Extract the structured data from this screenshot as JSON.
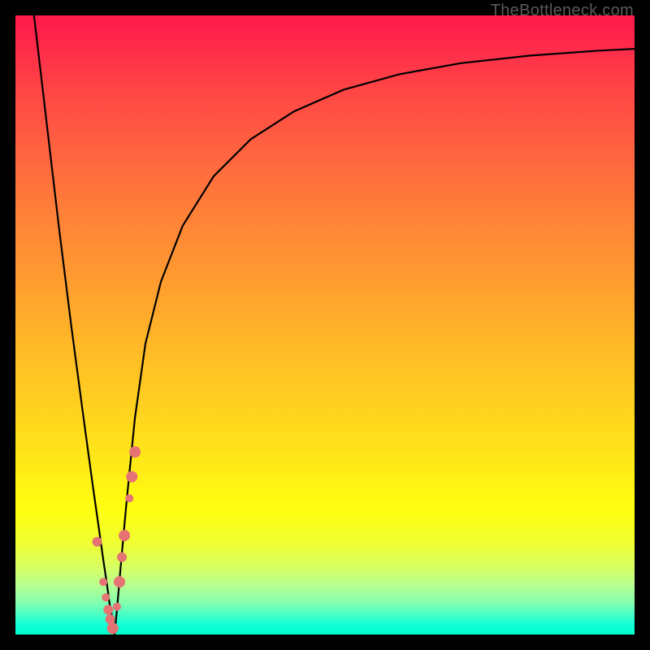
{
  "watermark": "TheBottleneck.com",
  "chart_data": {
    "type": "line",
    "title": "",
    "xlabel": "",
    "ylabel": "",
    "xlim": [
      0,
      100
    ],
    "ylim": [
      0,
      100
    ],
    "series": [
      {
        "name": "left-branch",
        "x": [
          3.0,
          5.0,
          7.0,
          9.0,
          11.0,
          12.5,
          13.5,
          14.2,
          14.8,
          15.2,
          15.6,
          15.85,
          16.0
        ],
        "y": [
          100,
          83,
          66,
          50,
          35,
          24,
          17,
          12,
          8,
          5,
          3,
          1.5,
          0
        ]
      },
      {
        "name": "right-branch",
        "x": [
          16.0,
          16.4,
          17.0,
          18.0,
          19.3,
          21.0,
          23.5,
          27.0,
          32.0,
          38.0,
          45.0,
          53.0,
          62.0,
          72.0,
          83.0,
          94.0,
          100.0
        ],
        "y": [
          0,
          4,
          11,
          22,
          35,
          47,
          57,
          66,
          74,
          80,
          84.5,
          88,
          90.5,
          92.3,
          93.5,
          94.3,
          94.6
        ]
      }
    ],
    "scatter_points": {
      "name": "dots",
      "x": [
        13.2,
        14.2,
        14.6,
        15.0,
        15.3,
        15.7,
        16.4,
        16.8,
        17.2,
        17.6,
        18.4,
        18.8,
        19.3
      ],
      "y": [
        15.0,
        8.5,
        6.0,
        4.0,
        2.5,
        1.0,
        4.5,
        8.5,
        12.5,
        16.0,
        22.0,
        25.5,
        29.5
      ],
      "radius": [
        6,
        5,
        5,
        6,
        6,
        7,
        5,
        7,
        6,
        7,
        5,
        7,
        7
      ]
    },
    "colors": {
      "curve": "#000000",
      "dots": "#e57373"
    }
  }
}
